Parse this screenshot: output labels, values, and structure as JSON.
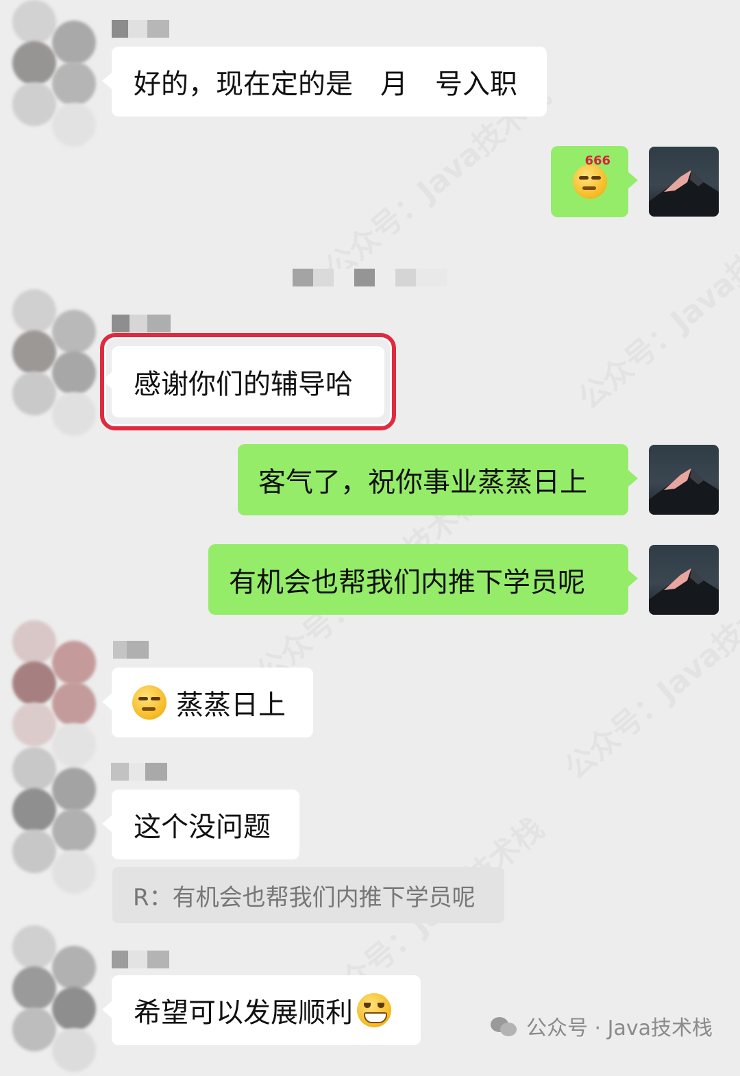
{
  "messages": {
    "m1": {
      "text": "好的，现在定的是　月　号入职"
    },
    "m3": {
      "text": "感谢你们的辅导哈"
    },
    "m4": {
      "text": "客气了，祝你事业蒸蒸日上"
    },
    "m5": {
      "text": "有机会也帮我们内推下学员呢"
    },
    "m6": {
      "text": "蒸蒸日上"
    },
    "m7": {
      "text": "这个没问题",
      "quote": "R：有机会也帮我们内推下学员呢"
    },
    "m8": {
      "text": "希望可以发展顺利"
    }
  },
  "sticker": {
    "label": "666"
  },
  "watermarks": [
    "公众号：Java技术栈",
    "公众号：Java技术栈",
    "公众号：Java技术栈",
    "公众号：Java技术栈",
    "公众号：Java技术栈"
  ],
  "footer": {
    "brand": "公众号 · Java技术栈"
  },
  "colors": {
    "self_bubble": "#95ec69",
    "other_bubble": "#ffffff",
    "background": "#ededed",
    "highlight": "#e02a3f"
  }
}
